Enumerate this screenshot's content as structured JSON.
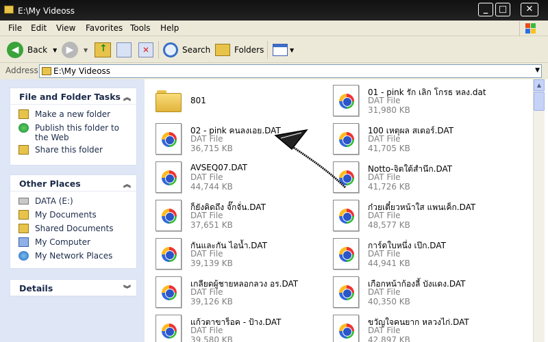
{
  "window": {
    "title": "E:\\My Videoss"
  },
  "menu": {
    "items": [
      "File",
      "Edit",
      "View",
      "Favorites",
      "Tools",
      "Help"
    ]
  },
  "toolbar": {
    "back_label": "Back",
    "search_label": "Search",
    "folders_label": "Folders"
  },
  "address": {
    "label": "Address",
    "value": "E:\\My Videoss"
  },
  "left_pane": {
    "file_tasks": {
      "title": "File and Folder Tasks",
      "items": [
        "Make a new folder",
        "Publish this folder to the Web",
        "Share this folder"
      ]
    },
    "other_places": {
      "title": "Other Places",
      "items": [
        "DATA (E:)",
        "My Documents",
        "Shared Documents",
        "My Computer",
        "My Network Places"
      ]
    },
    "details": {
      "title": "Details"
    }
  },
  "files": [
    {
      "name": "801",
      "type": "",
      "size": "",
      "kind": "folder"
    },
    {
      "name": "01 - pink รัก เลิก โกรธ หลง.dat",
      "type": "DAT File",
      "size": "31,980 KB",
      "kind": "dat"
    },
    {
      "name": "02 - pink คนลงเอย.DAT",
      "type": "DAT File",
      "size": "36,715 KB",
      "kind": "dat"
    },
    {
      "name": "100 เหตุผล สเตอร์.DAT",
      "type": "DAT File",
      "size": "41,705 KB",
      "kind": "dat"
    },
    {
      "name": "AVSEQ07.DAT",
      "type": "DAT File",
      "size": "44,744 KB",
      "kind": "dat"
    },
    {
      "name": "Notto-จิตใต้สำนึก.DAT",
      "type": "DAT File",
      "size": "41,726 KB",
      "kind": "dat"
    },
    {
      "name": "ก็ยังคิดถึง จั๊กจั่น.DAT",
      "type": "DAT File",
      "size": "37,651 KB",
      "kind": "dat"
    },
    {
      "name": "ก๋วยเตี๋ยวหน้าใส  แพนเค็ก.DAT",
      "type": "DAT File",
      "size": "48,577 KB",
      "kind": "dat"
    },
    {
      "name": "กันและกัน ไอน้ำ.DAT",
      "type": "DAT File",
      "size": "39,139 KB",
      "kind": "dat"
    },
    {
      "name": "การ์ดใบหนึ่ง เป๊ก.DAT",
      "type": "DAT File",
      "size": "44,941 KB",
      "kind": "dat"
    },
    {
      "name": "เกลียดผู้ชายหลอกลวง อร.DAT",
      "type": "DAT File",
      "size": "39,126 KB",
      "kind": "dat"
    },
    {
      "name": "เกือกหน้าก้องลี้ บังแดง.DAT",
      "type": "DAT File",
      "size": "40,350 KB",
      "kind": "dat"
    },
    {
      "name": "แก้วตาขาร็อค - ป้าง.DAT",
      "type": "DAT File",
      "size": "39,580 KB",
      "kind": "dat"
    },
    {
      "name": "ขวัญใจคนยาก หลวงไก่.DAT",
      "type": "DAT File",
      "size": "42,897 KB",
      "kind": "dat"
    }
  ]
}
